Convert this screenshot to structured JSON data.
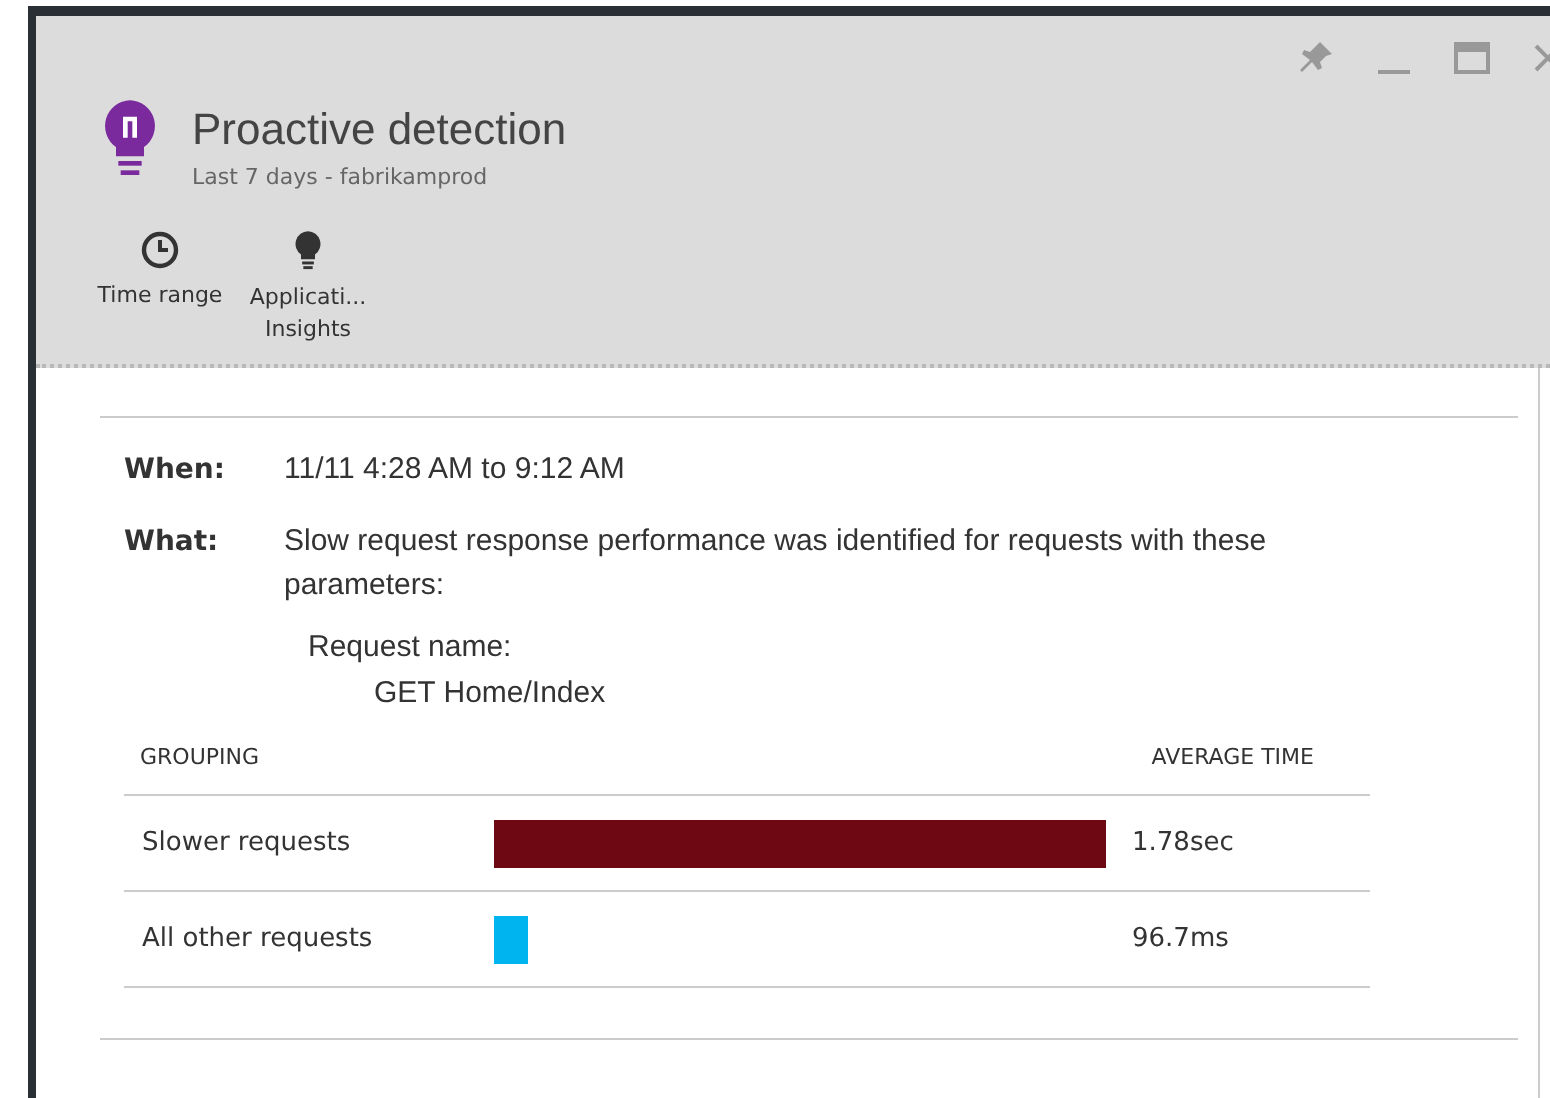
{
  "blade": {
    "title": "Proactive detection",
    "subtitle": "Last 7 days - fabrikamprod"
  },
  "toolbar": [
    {
      "kind": "clock",
      "label": "Time range"
    },
    {
      "kind": "bulb",
      "label": "Applicati...\nInsights"
    }
  ],
  "details": [
    {
      "label": "When:",
      "value": "11/11 4:28 AM to 9:12 AM"
    },
    {
      "label": "What:",
      "value": "Slow request response performance was identified for requests with these parameters:"
    }
  ],
  "parameter": {
    "label": "Request name:",
    "value": "GET Home/Index"
  },
  "table": {
    "columns": [
      "GROUPING",
      "AVERAGE TIME"
    ],
    "rows": [
      {
        "grouping": "Slower requests",
        "color": "#6e0812",
        "time": "1.78sec"
      },
      {
        "grouping": "All other requests",
        "color": "#00b4ef",
        "time": "96.7ms"
      }
    ]
  }
}
